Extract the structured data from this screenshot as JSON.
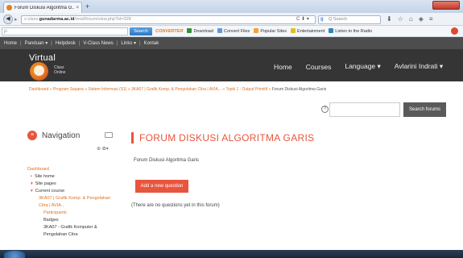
{
  "browser": {
    "tab_title": "Forum Diskusi Algoritma G...",
    "tab_close": "×",
    "new_tab": "+",
    "url_prefix": "v-class.",
    "url_domain": "gunadarma.ac.id",
    "url_rest": "/mod/forum/view.php?id=328",
    "search_placeholder": "Q Search",
    "toolbar_icons": [
      "download-icon",
      "star-icon",
      "home-icon",
      "shield-icon",
      "menu-icon"
    ]
  },
  "bookmarks": {
    "search_button": "Search",
    "brand": "CONVERTER",
    "items": [
      "Download",
      "Convert Files",
      "Popular Sites",
      "Entertainment",
      "Listen to the Radio"
    ]
  },
  "site_top": {
    "links": [
      "Home",
      "Panduan ▾",
      "Helpdesk",
      "V-Class News",
      "Links ▾",
      "Kontak"
    ]
  },
  "header": {
    "logo_text": "Virtual",
    "logo_sub": [
      "Class",
      "Online"
    ],
    "menu": [
      "Home",
      "Courses",
      "Language ▾"
    ],
    "user": "Avlarini Indrati ▾"
  },
  "breadcrumb": {
    "path": "Dashboard » Program Sarjana » Sistem Informasi (S1) » 3KA07 | Grafik Komp. & Pengolahan Citra | AVIA... » Topik 1 : Output Primitif » ",
    "current": "Forum Diskusi Algoritma Garis"
  },
  "forum_search": {
    "button": "Search forums",
    "help": "?"
  },
  "navigation": {
    "title": "Navigation",
    "dashboard": "Dashboard",
    "items": [
      "Site home",
      "Site pages",
      "Current course"
    ],
    "course": "3KA07 | Grafik Komp. & Pengolahan Citra | AVIA...",
    "course_children": [
      "Participants",
      "Badges",
      "3KA07 - Grafik Komputer & Pengolahan Citra"
    ],
    "controls": "⊕ ✿▾"
  },
  "main": {
    "title": "FORUM DISKUSI ALGORITMA GARIS",
    "description": "Forum Diskusi Algoritma Garis",
    "add_button": "Add a new question",
    "empty_text": "(There are no questions yet in this forum)"
  },
  "colors": {
    "accent": "#e8553d",
    "header_bg": "#353535",
    "topbar_bg": "#4d4d4d"
  }
}
